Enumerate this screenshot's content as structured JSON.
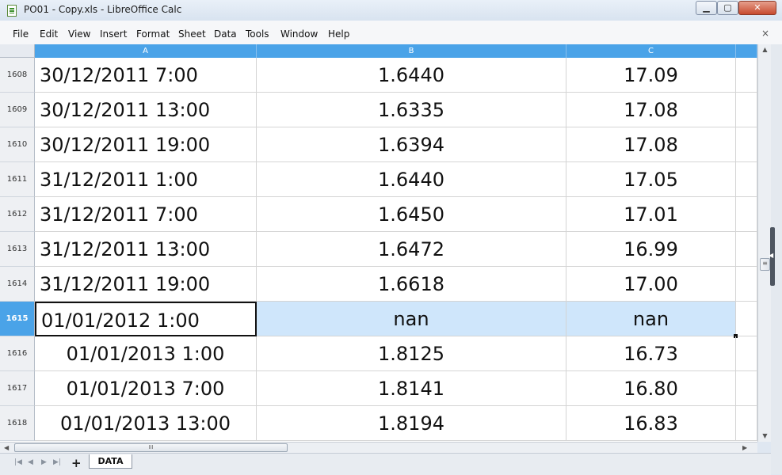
{
  "window": {
    "title": "PO01 - Copy.xls - LibreOffice Calc",
    "icon": "calc-document-icon",
    "controls": {
      "minimize": "▁",
      "maximize": "▢",
      "close": "✕"
    }
  },
  "menu": {
    "items": [
      "File",
      "Edit",
      "View",
      "Insert",
      "Format",
      "Sheet",
      "Data",
      "Tools",
      "Window",
      "Help"
    ],
    "close_document": "×"
  },
  "grid": {
    "columns": [
      "A",
      "B",
      "C"
    ],
    "rows": [
      {
        "num": "1608",
        "a": "30/12/2011 7:00",
        "b": "1.6440",
        "c": "17.09"
      },
      {
        "num": "1609",
        "a": "30/12/2011 13:00",
        "b": "1.6335",
        "c": "17.08"
      },
      {
        "num": "1610",
        "a": "30/12/2011 19:00",
        "b": "1.6394",
        "c": "17.08"
      },
      {
        "num": "1611",
        "a": "31/12/2011 1:00",
        "b": "1.6440",
        "c": "17.05"
      },
      {
        "num": "1612",
        "a": "31/12/2011 7:00",
        "b": "1.6450",
        "c": "17.01"
      },
      {
        "num": "1613",
        "a": "31/12/2011 13:00",
        "b": "1.6472",
        "c": "16.99"
      },
      {
        "num": "1614",
        "a": "31/12/2011 19:00",
        "b": "1.6618",
        "c": "17.00"
      },
      {
        "num": "1615",
        "a": "01/01/2012 1:00",
        "b": "nan",
        "c": "nan"
      },
      {
        "num": "1616",
        "a": "01/01/2013 1:00",
        "b": "1.8125",
        "c": "16.73"
      },
      {
        "num": "1617",
        "a": "01/01/2013 7:00",
        "b": "1.8141",
        "c": "16.80"
      },
      {
        "num": "1618",
        "a": "01/01/2013 13:00",
        "b": "1.8194",
        "c": "16.83"
      }
    ],
    "selected_row": "1615"
  },
  "sheets": {
    "tabs": [
      "DATA"
    ],
    "add_label": "+"
  }
}
